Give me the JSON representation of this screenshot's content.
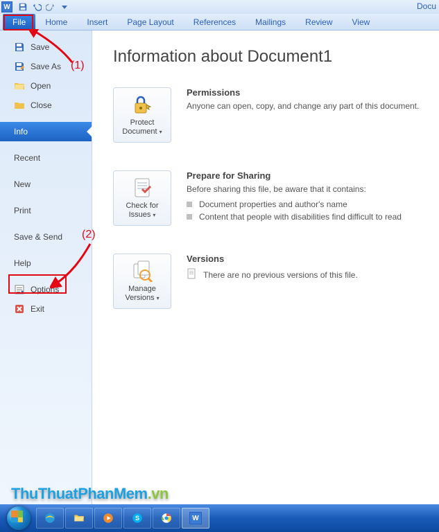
{
  "qat": {
    "app_letter": "W",
    "title_right": "Docu"
  },
  "ribbon": {
    "file": "File",
    "home": "Home",
    "insert": "Insert",
    "page_layout": "Page Layout",
    "references": "References",
    "mailings": "Mailings",
    "review": "Review",
    "view": "View"
  },
  "sidebar": {
    "save": "Save",
    "save_as": "Save As",
    "open": "Open",
    "close": "Close",
    "info": "Info",
    "recent": "Recent",
    "new": "New",
    "print": "Print",
    "save_send": "Save & Send",
    "help": "Help",
    "options": "Options",
    "exit": "Exit"
  },
  "content": {
    "heading": "Information about Document1",
    "permissions": {
      "btn_line1": "Protect",
      "btn_line2": "Document",
      "title": "Permissions",
      "text": "Anyone can open, copy, and change any part of this document."
    },
    "prepare": {
      "btn_line1": "Check for",
      "btn_line2": "Issues",
      "title": "Prepare for Sharing",
      "lead": "Before sharing this file, be aware that it contains:",
      "items": [
        "Document properties and author's name",
        "Content that people with disabilities find difficult to read"
      ]
    },
    "versions": {
      "btn_line1": "Manage",
      "btn_line2": "Versions",
      "title": "Versions",
      "text": "There are no previous versions of this file."
    }
  },
  "annotations": {
    "one": "(1)",
    "two": "(2)"
  },
  "watermark": {
    "a": "ThuThuatPhanMem",
    "b": ".vn"
  }
}
